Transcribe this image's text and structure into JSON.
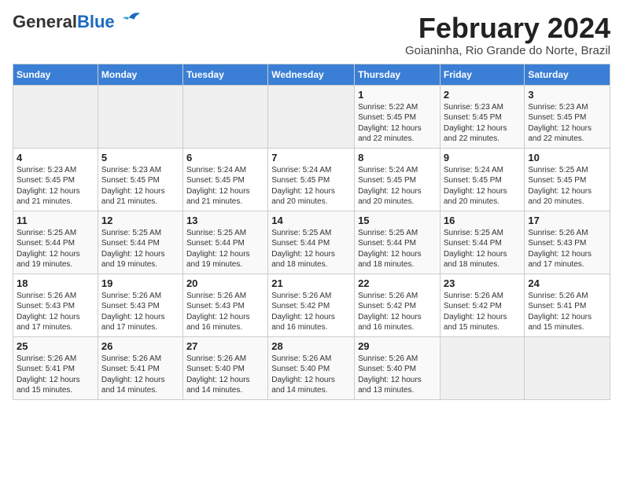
{
  "header": {
    "logo_line1": "General",
    "logo_line2": "Blue",
    "month_year": "February 2024",
    "location": "Goianinha, Rio Grande do Norte, Brazil"
  },
  "weekdays": [
    "Sunday",
    "Monday",
    "Tuesday",
    "Wednesday",
    "Thursday",
    "Friday",
    "Saturday"
  ],
  "weeks": [
    [
      {
        "day": "",
        "info": ""
      },
      {
        "day": "",
        "info": ""
      },
      {
        "day": "",
        "info": ""
      },
      {
        "day": "",
        "info": ""
      },
      {
        "day": "1",
        "info": "Sunrise: 5:22 AM\nSunset: 5:45 PM\nDaylight: 12 hours\nand 22 minutes."
      },
      {
        "day": "2",
        "info": "Sunrise: 5:23 AM\nSunset: 5:45 PM\nDaylight: 12 hours\nand 22 minutes."
      },
      {
        "day": "3",
        "info": "Sunrise: 5:23 AM\nSunset: 5:45 PM\nDaylight: 12 hours\nand 22 minutes."
      }
    ],
    [
      {
        "day": "4",
        "info": "Sunrise: 5:23 AM\nSunset: 5:45 PM\nDaylight: 12 hours\nand 21 minutes."
      },
      {
        "day": "5",
        "info": "Sunrise: 5:23 AM\nSunset: 5:45 PM\nDaylight: 12 hours\nand 21 minutes."
      },
      {
        "day": "6",
        "info": "Sunrise: 5:24 AM\nSunset: 5:45 PM\nDaylight: 12 hours\nand 21 minutes."
      },
      {
        "day": "7",
        "info": "Sunrise: 5:24 AM\nSunset: 5:45 PM\nDaylight: 12 hours\nand 20 minutes."
      },
      {
        "day": "8",
        "info": "Sunrise: 5:24 AM\nSunset: 5:45 PM\nDaylight: 12 hours\nand 20 minutes."
      },
      {
        "day": "9",
        "info": "Sunrise: 5:24 AM\nSunset: 5:45 PM\nDaylight: 12 hours\nand 20 minutes."
      },
      {
        "day": "10",
        "info": "Sunrise: 5:25 AM\nSunset: 5:45 PM\nDaylight: 12 hours\nand 20 minutes."
      }
    ],
    [
      {
        "day": "11",
        "info": "Sunrise: 5:25 AM\nSunset: 5:44 PM\nDaylight: 12 hours\nand 19 minutes."
      },
      {
        "day": "12",
        "info": "Sunrise: 5:25 AM\nSunset: 5:44 PM\nDaylight: 12 hours\nand 19 minutes."
      },
      {
        "day": "13",
        "info": "Sunrise: 5:25 AM\nSunset: 5:44 PM\nDaylight: 12 hours\nand 19 minutes."
      },
      {
        "day": "14",
        "info": "Sunrise: 5:25 AM\nSunset: 5:44 PM\nDaylight: 12 hours\nand 18 minutes."
      },
      {
        "day": "15",
        "info": "Sunrise: 5:25 AM\nSunset: 5:44 PM\nDaylight: 12 hours\nand 18 minutes."
      },
      {
        "day": "16",
        "info": "Sunrise: 5:25 AM\nSunset: 5:44 PM\nDaylight: 12 hours\nand 18 minutes."
      },
      {
        "day": "17",
        "info": "Sunrise: 5:26 AM\nSunset: 5:43 PM\nDaylight: 12 hours\nand 17 minutes."
      }
    ],
    [
      {
        "day": "18",
        "info": "Sunrise: 5:26 AM\nSunset: 5:43 PM\nDaylight: 12 hours\nand 17 minutes."
      },
      {
        "day": "19",
        "info": "Sunrise: 5:26 AM\nSunset: 5:43 PM\nDaylight: 12 hours\nand 17 minutes."
      },
      {
        "day": "20",
        "info": "Sunrise: 5:26 AM\nSunset: 5:43 PM\nDaylight: 12 hours\nand 16 minutes."
      },
      {
        "day": "21",
        "info": "Sunrise: 5:26 AM\nSunset: 5:42 PM\nDaylight: 12 hours\nand 16 minutes."
      },
      {
        "day": "22",
        "info": "Sunrise: 5:26 AM\nSunset: 5:42 PM\nDaylight: 12 hours\nand 16 minutes."
      },
      {
        "day": "23",
        "info": "Sunrise: 5:26 AM\nSunset: 5:42 PM\nDaylight: 12 hours\nand 15 minutes."
      },
      {
        "day": "24",
        "info": "Sunrise: 5:26 AM\nSunset: 5:41 PM\nDaylight: 12 hours\nand 15 minutes."
      }
    ],
    [
      {
        "day": "25",
        "info": "Sunrise: 5:26 AM\nSunset: 5:41 PM\nDaylight: 12 hours\nand 15 minutes."
      },
      {
        "day": "26",
        "info": "Sunrise: 5:26 AM\nSunset: 5:41 PM\nDaylight: 12 hours\nand 14 minutes."
      },
      {
        "day": "27",
        "info": "Sunrise: 5:26 AM\nSunset: 5:40 PM\nDaylight: 12 hours\nand 14 minutes."
      },
      {
        "day": "28",
        "info": "Sunrise: 5:26 AM\nSunset: 5:40 PM\nDaylight: 12 hours\nand 14 minutes."
      },
      {
        "day": "29",
        "info": "Sunrise: 5:26 AM\nSunset: 5:40 PM\nDaylight: 12 hours\nand 13 minutes."
      },
      {
        "day": "",
        "info": ""
      },
      {
        "day": "",
        "info": ""
      }
    ]
  ]
}
